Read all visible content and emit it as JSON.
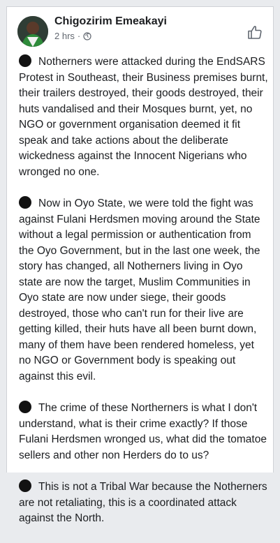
{
  "post": {
    "author": "Chigozirim Emeakayi",
    "time": "2 hrs",
    "separator": "·",
    "privacy_icon": "globe-icon",
    "like_icon": "thumbs-up-icon",
    "bullet_icon": "black-circle-emoji",
    "paragraphs": [
      "Notherners were attacked during the EndSARS Protest in Southeast, their Business premises burnt, their trailers destroyed, their goods destroyed, their huts vandalised and their Mosques burnt, yet, no NGO or government organisation deemed it fit speak and take actions about the deliberate wickedness against the Innocent Nigerians who wronged no one.",
      "Now in Oyo State, we were told the fight was against Fulani Herdsmen moving around the State without a legal permission or authentication from the Oyo Government, but in the last one week, the story has changed, all Notherners living in Oyo state are now the target, Muslim Communities in Oyo state are now under siege, their goods destroyed, those who can't run for their live are getting killed, their huts have all been burnt down, many of them have been rendered homeless, yet no NGO or Government body is speaking out against this evil.",
      "The crime of these Northerners is what I don't understand, what is their crime exactly? If those Fulani Herdsmen wronged us, what did the tomatoe sellers and other non Herders do to us?",
      "This is not a Tribal War because the Notherners are not retaliating, this is a coordinated attack against the North."
    ]
  }
}
